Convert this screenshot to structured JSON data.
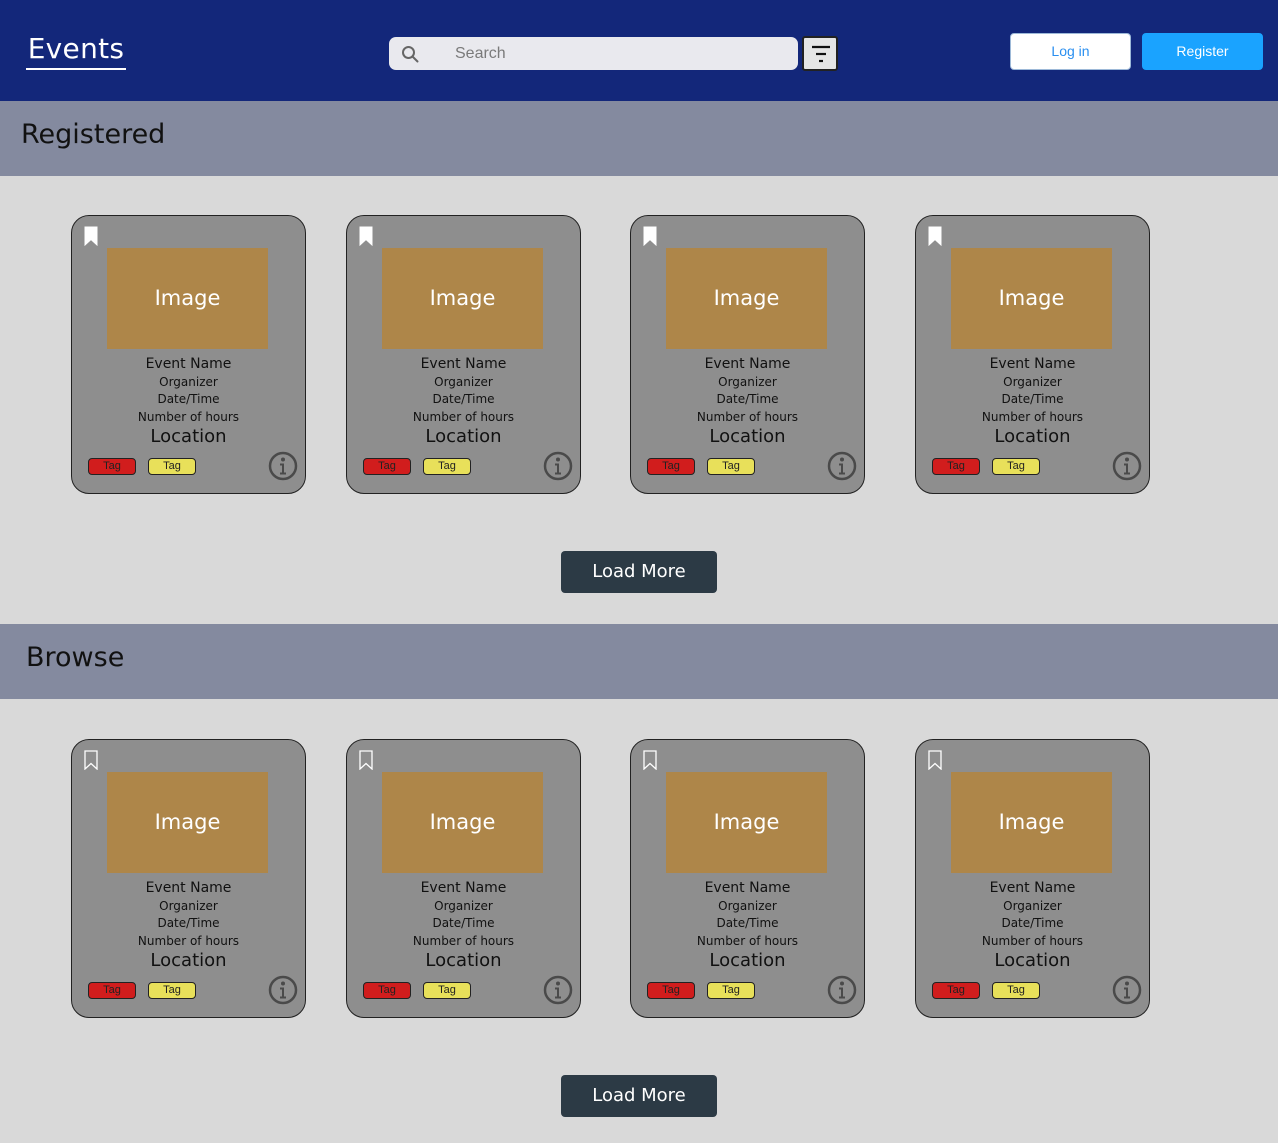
{
  "header": {
    "title": "Events",
    "search_placeholder": "Search",
    "login_label": "Log in",
    "register_label": "Register"
  },
  "registered": {
    "title": "Registered",
    "load_more_label": "Load More",
    "cards": [
      {
        "image": "Image",
        "name": "Event Name",
        "organizer": "Organizer",
        "datetime": "Date/Time",
        "hours": "Number of hours",
        "location": "Location",
        "tag1": "Tag",
        "tag2": "Tag",
        "bookmarked": true
      },
      {
        "image": "Image",
        "name": "Event Name",
        "organizer": "Organizer",
        "datetime": "Date/Time",
        "hours": "Number of hours",
        "location": "Location",
        "tag1": "Tag",
        "tag2": "Tag",
        "bookmarked": true
      },
      {
        "image": "Image",
        "name": "Event Name",
        "organizer": "Organizer",
        "datetime": "Date/Time",
        "hours": "Number of hours",
        "location": "Location",
        "tag1": "Tag",
        "tag2": "Tag",
        "bookmarked": true
      },
      {
        "image": "Image",
        "name": "Event Name",
        "organizer": "Organizer",
        "datetime": "Date/Time",
        "hours": "Number of hours",
        "location": "Location",
        "tag1": "Tag",
        "tag2": "Tag",
        "bookmarked": true
      }
    ]
  },
  "browse": {
    "title": "Browse",
    "load_more_label": "Load More",
    "cards": [
      {
        "image": "Image",
        "name": "Event Name",
        "organizer": "Organizer",
        "datetime": "Date/Time",
        "hours": "Number of hours",
        "location": "Location",
        "tag1": "Tag",
        "tag2": "Tag",
        "bookmarked": false
      },
      {
        "image": "Image",
        "name": "Event Name",
        "organizer": "Organizer",
        "datetime": "Date/Time",
        "hours": "Number of hours",
        "location": "Location",
        "tag1": "Tag",
        "tag2": "Tag",
        "bookmarked": false
      },
      {
        "image": "Image",
        "name": "Event Name",
        "organizer": "Organizer",
        "datetime": "Date/Time",
        "hours": "Number of hours",
        "location": "Location",
        "tag1": "Tag",
        "tag2": "Tag",
        "bookmarked": false
      },
      {
        "image": "Image",
        "name": "Event Name",
        "organizer": "Organizer",
        "datetime": "Date/Time",
        "hours": "Number of hours",
        "location": "Location",
        "tag1": "Tag",
        "tag2": "Tag",
        "bookmarked": false
      }
    ]
  },
  "colors": {
    "header_bg": "#13277a",
    "section_bg": "#848a9f",
    "page_bg": "#d9d9d9",
    "card_bg": "#8e8e8e",
    "image_placeholder": "#ae8649",
    "tag_red": "#d11d1d",
    "tag_yellow": "#e8e05a",
    "register_accent": "#1aa3ff",
    "load_more_bg": "#2c3a45"
  },
  "icons": {
    "search": "search-icon",
    "filter": "filter-icon",
    "bookmark_filled": "bookmark-filled-icon",
    "bookmark_outline": "bookmark-outline-icon",
    "info": "info-icon"
  }
}
